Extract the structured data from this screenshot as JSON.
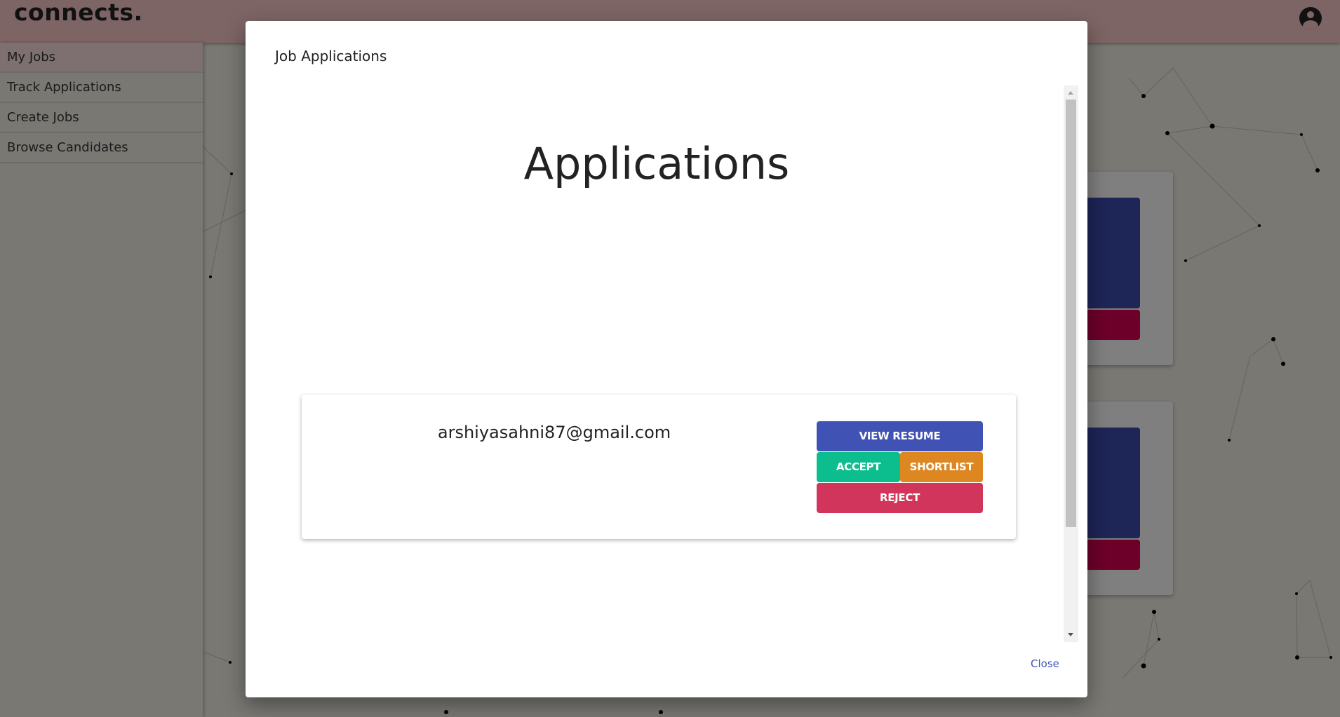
{
  "header": {
    "logo": "connects.",
    "avatar_icon": "account-circle-icon"
  },
  "sidebar": {
    "items": [
      {
        "label": "My Jobs",
        "active": true
      },
      {
        "label": "Track Applications"
      },
      {
        "label": "Create Jobs"
      },
      {
        "label": "Browse Candidates"
      }
    ]
  },
  "modal": {
    "title": "Job Applications",
    "heading": "Applications",
    "applications": [
      {
        "email": "arshiyasahni87@gmail.com",
        "view_resume": "VIEW RESUME",
        "accept": "ACCEPT",
        "shortlist": "SHORTLIST",
        "reject": "REJECT"
      }
    ],
    "close": "Close"
  },
  "colors": {
    "header": "#7e6565",
    "view_resume": "#4152b5",
    "accept": "#0cbe8d",
    "shortlist": "#dd8721",
    "reject": "#d1355b",
    "close": "#4152b5"
  }
}
